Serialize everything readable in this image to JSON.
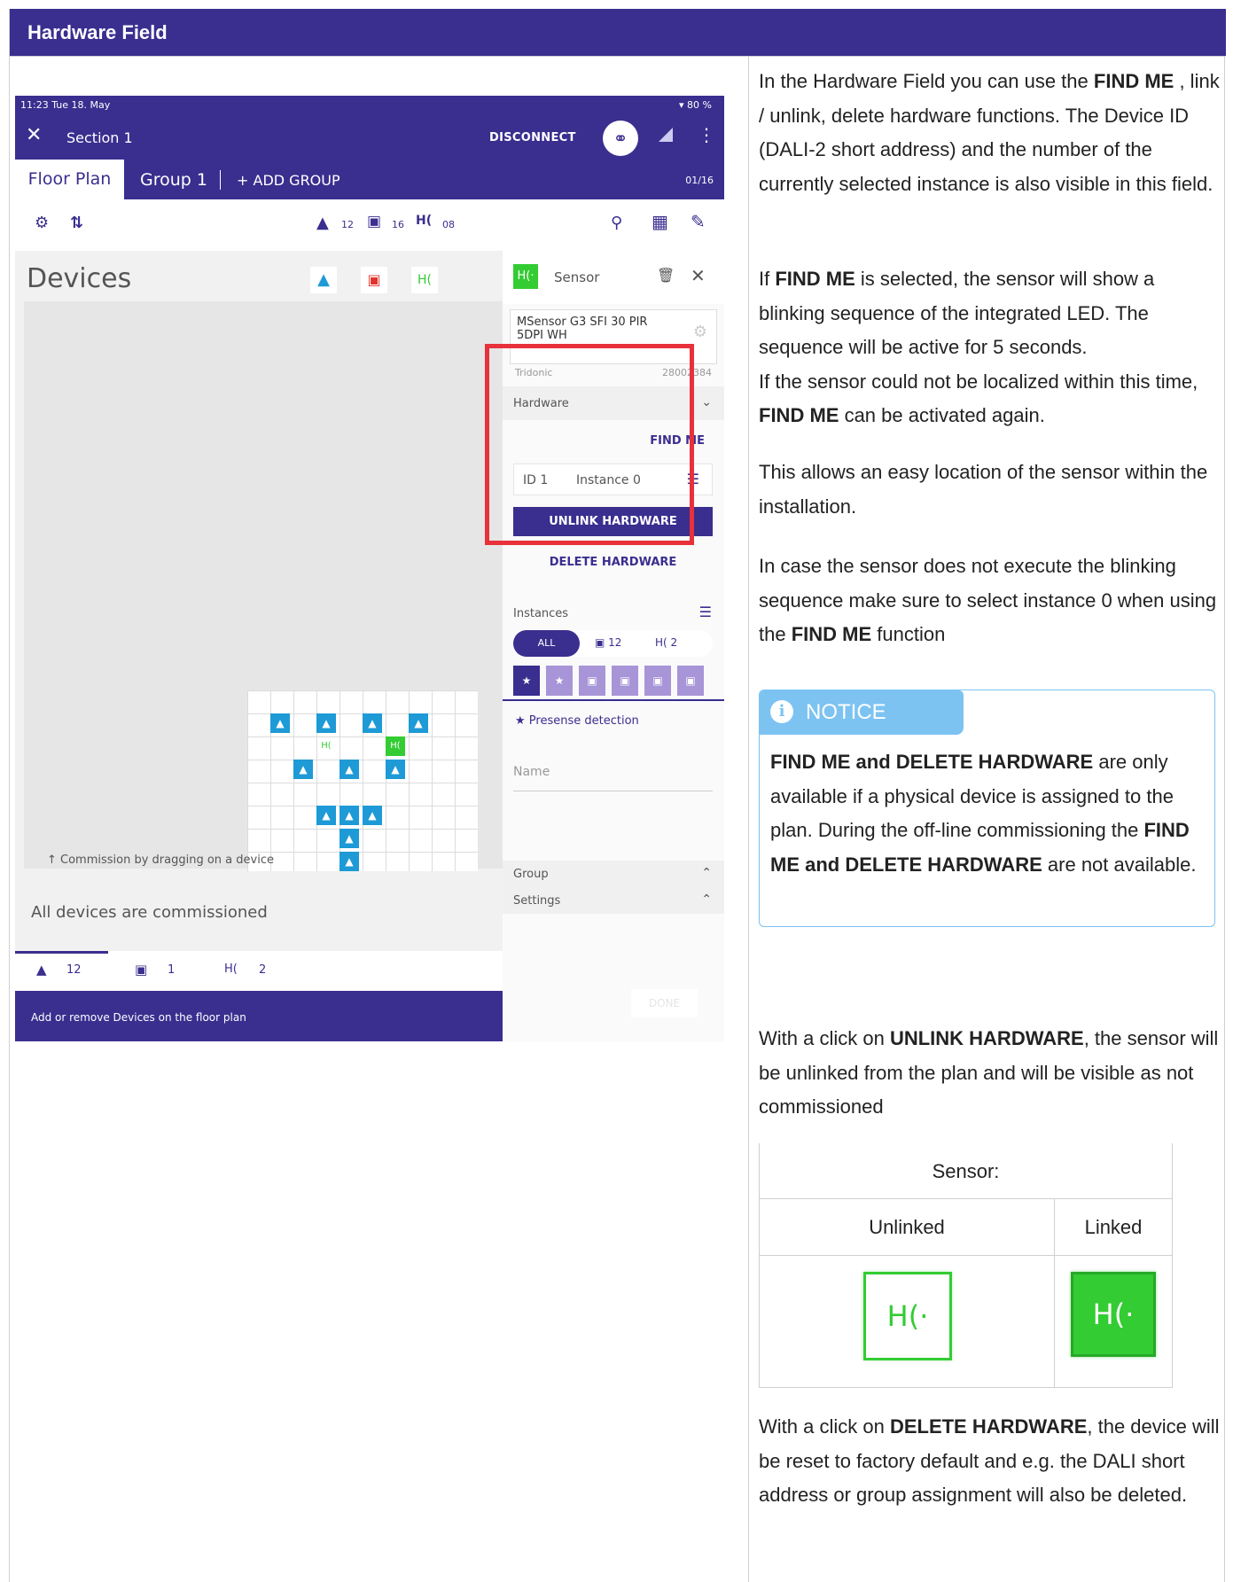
{
  "header": {
    "title": "Hardware Field"
  },
  "screenshot": {
    "statusbar": {
      "time": "11:23  Tue 18. May",
      "battery": "▾ 80 %"
    },
    "appbar": {
      "close": "✕",
      "section": "Section 1",
      "disconnect": "DISCONNECT",
      "link_icon": "⚭",
      "menu": "⋮"
    },
    "tabs": {
      "floor_plan": "Floor Plan",
      "group1": "Group 1",
      "add_group": "+ ADD GROUP",
      "count": "01/16"
    },
    "toolbar": {
      "luminaires": "12",
      "pushbuttons": "16",
      "sensors": "08"
    },
    "devices_title": "Devices",
    "hint": "↑   Commission by dragging on a device",
    "commissioned": "All devices are commissioned",
    "bottom_tabs": {
      "luminaires": "12",
      "pushbuttons": "1",
      "sensors": "2"
    },
    "bottom_bar": "Add or remove Devices on the floor plan",
    "panel": {
      "sensor_icon": "H(·",
      "sensor": "Sensor",
      "model": "MSensor G3 SFI 30 PIR 5DPI WH",
      "vendor": "Tridonic",
      "serial": "28002384",
      "hardware": "Hardware",
      "find_me": "FIND ME",
      "id": "ID 1",
      "instance": "Instance 0",
      "unlink": "UNLINK HARDWARE",
      "delete": "DELETE HARDWARE",
      "instances": "Instances",
      "all": "ALL",
      "chip_push": "12",
      "chip_sensor": "2",
      "presence": "Presense detection",
      "name": "Name",
      "group": "Group",
      "settings": "Settings",
      "done": "DONE"
    }
  },
  "text": {
    "p1": {
      "a": "In the Hardware Field you can use the ",
      "b": "FIND ME",
      "c": " , link / unlink, delete hardware functions. The Device ID (DALI-2 short address) and the number of the currently selected instance is also visible in this field."
    },
    "p2": {
      "a": "If ",
      "b": "FIND ME",
      "c": " is selected, the sensor will show a blinking sequence of the integrated LED. The sequence will be active for 5 seconds.",
      "d": "If the sensor could not be localized within this time, ",
      "e": "FIND ME",
      "f": " can be activated again."
    },
    "p3": "This allows an easy location of the sensor within the installation.",
    "p4": {
      "a": "In case the sensor does not execute the blinking sequence make sure to select instance 0 when using the ",
      "b": "FIND ME",
      "c": " function"
    },
    "notice": {
      "icon": "i",
      "label": "NOTICE",
      "a": "FIND ME and DELETE HARDWARE",
      "b": " are only available if a physical device is assigned to the plan. During the off-line commissioning the ",
      "c": "FIND ME and DELETE HARDWARE",
      "d": " are not available."
    },
    "p5": {
      "a": "With a click on ",
      "b": "UNLINK HARDWARE",
      "c": ", the sensor will be unlinked from the plan and will be visible as not commissioned"
    },
    "table": {
      "title": "Sensor:",
      "col1": "Unlinked",
      "col2": "Linked",
      "icon_glyph": "H(·"
    },
    "p6": {
      "a": "With a click on ",
      "b": "DELETE HARDWARE",
      "c": ", the device will be reset to factory default and e.g. the DALI short address or group assignment will also be deleted."
    }
  },
  "colors": {
    "brand": "#3a2e8f",
    "notice": "#7cc3f2",
    "highlight": "#e8313a",
    "sensor_green": "#33cc33",
    "luminaire_blue": "#1e9ad6",
    "pushbutton_red": "#e0312b"
  }
}
